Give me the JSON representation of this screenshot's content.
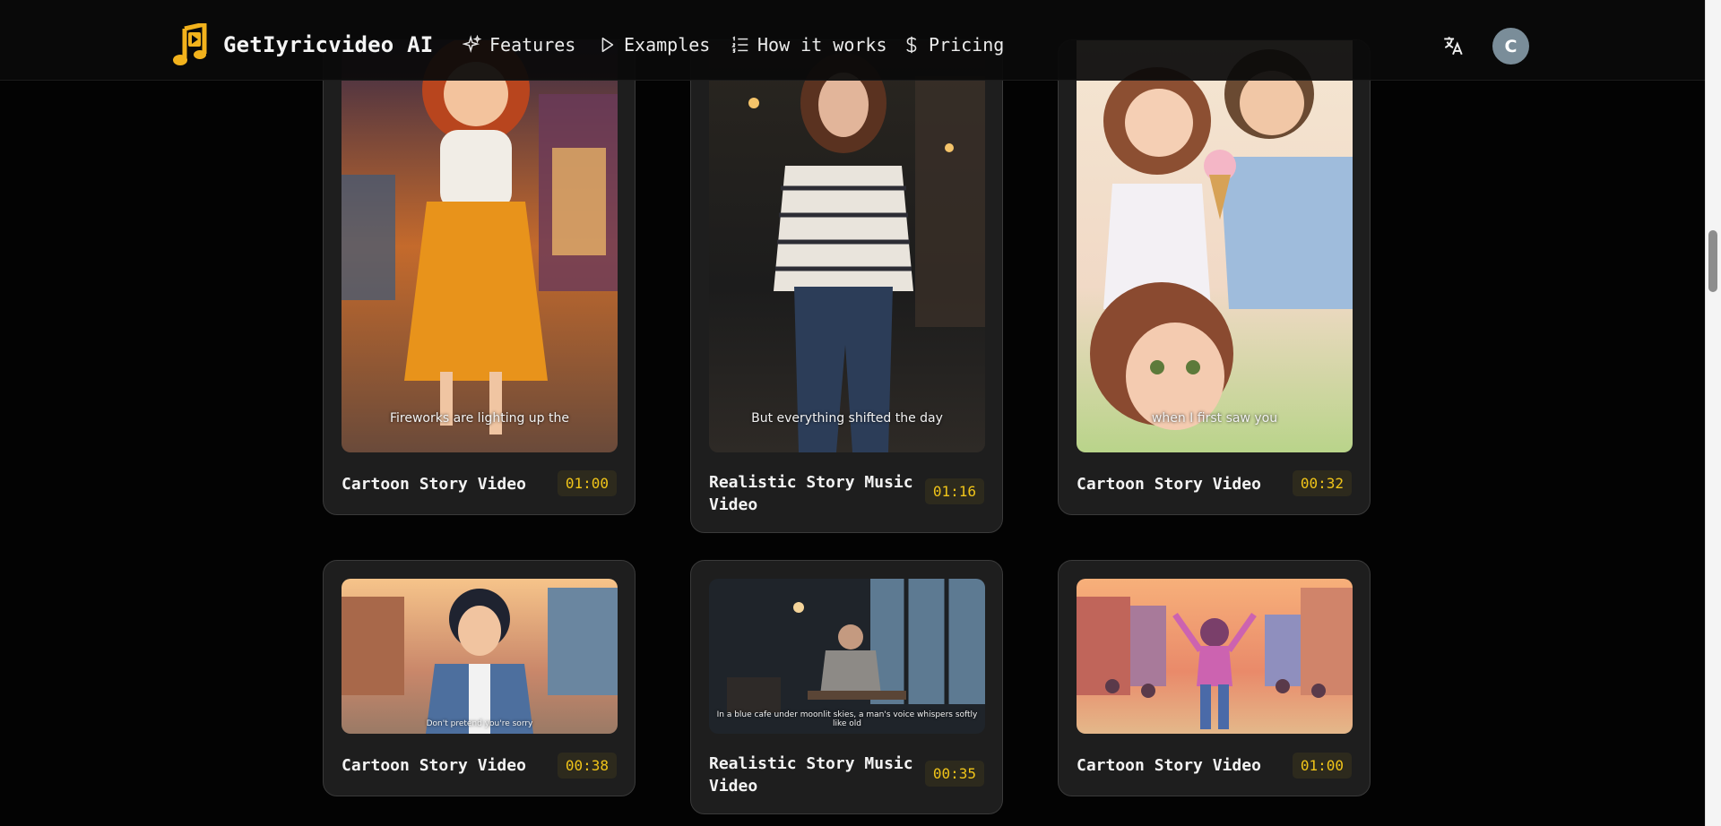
{
  "brand": {
    "name": "GetIyricvideo AI"
  },
  "nav": [
    {
      "label": "Features",
      "icon": "sparkles-icon"
    },
    {
      "label": "Examples",
      "icon": "play-icon"
    },
    {
      "label": "How it works",
      "icon": "list-ordered-icon"
    },
    {
      "label": "Pricing",
      "icon": "dollar-icon"
    }
  ],
  "user": {
    "initial": "C"
  },
  "colors": {
    "accent": "#f0c419",
    "logo": "#f2b21c",
    "card_bg": "#1e1e1e",
    "page_bg": "#030303"
  },
  "cards": [
    {
      "title": "Cartoon Story Video",
      "duration": "01:00",
      "caption": "Fireworks are lighting up the"
    },
    {
      "title": "Realistic Story Music Video",
      "duration": "01:16",
      "caption": "But everything shifted the day"
    },
    {
      "title": "Cartoon Story Video",
      "duration": "00:32",
      "caption": "when I first saw you"
    },
    {
      "title": "Cartoon Story Video",
      "duration": "00:38",
      "caption": "Don't pretend you're sorry"
    },
    {
      "title": "Realistic Story Music Video",
      "duration": "00:35",
      "caption": "In a blue cafe under moonlit skies, a man's voice whispers softly like old"
    },
    {
      "title": "Cartoon Story Video",
      "duration": "01:00",
      "caption": ""
    }
  ]
}
